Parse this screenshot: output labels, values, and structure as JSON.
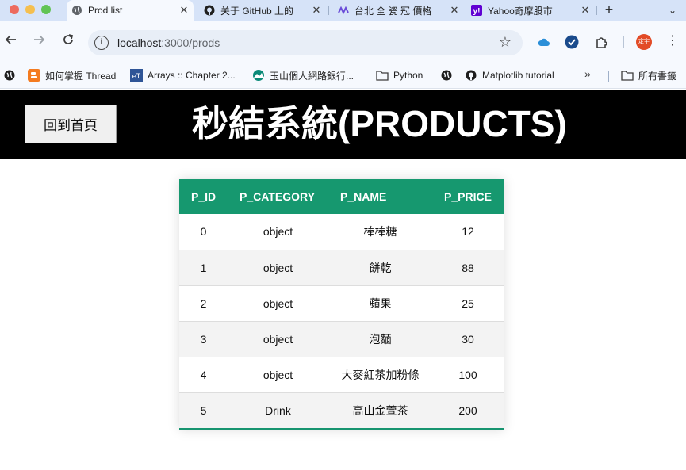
{
  "browser": {
    "tabs": [
      {
        "title": "Prod list",
        "icon": "globe-icon",
        "active": true
      },
      {
        "title": "关于 GitHub 上的",
        "icon": "github-icon",
        "active": false
      },
      {
        "title": "台北 全 瓷 冠 價格",
        "icon": "wave-icon",
        "active": false
      },
      {
        "title": "Yahoo奇摩股市",
        "icon": "yahoo-icon",
        "active": false
      }
    ],
    "tab_close": "✕",
    "new_tab": "+",
    "tab_menu": "⌄",
    "url_host": "localhost",
    "url_rest": ":3000/prods",
    "avatar_text": "定宇",
    "bookmarks": [
      {
        "label": "",
        "icon": "globe-icon"
      },
      {
        "label": "如何掌握 Thread",
        "icon": "blogger-icon"
      },
      {
        "label": "Arrays :: Chapter 2...",
        "icon": "et-icon"
      },
      {
        "label": "玉山個人網路銀行...",
        "icon": "esun-icon"
      },
      {
        "label": "Python",
        "icon": "folder-icon"
      },
      {
        "label": "",
        "icon": "globe-icon"
      },
      {
        "label": "Matplotlib tutorial",
        "icon": "github-icon"
      }
    ],
    "bookmarks_more": "»",
    "all_bookmarks": "所有書籤"
  },
  "page": {
    "home_button": "回到首頁",
    "title": "秒結系統(PRODUCTS)",
    "accent_color": "#16986f",
    "table": {
      "headers": [
        "P_ID",
        "P_CATEGORY",
        "P_NAME",
        "P_PRICE"
      ],
      "rows": [
        [
          "0",
          "object",
          "棒棒糖",
          "12"
        ],
        [
          "1",
          "object",
          "餅乾",
          "88"
        ],
        [
          "2",
          "object",
          "蘋果",
          "25"
        ],
        [
          "3",
          "object",
          "泡麵",
          "30"
        ],
        [
          "4",
          "object",
          "大麥紅茶加粉條",
          "100"
        ],
        [
          "5",
          "Drink",
          "高山金萱茶",
          "200"
        ]
      ]
    }
  }
}
